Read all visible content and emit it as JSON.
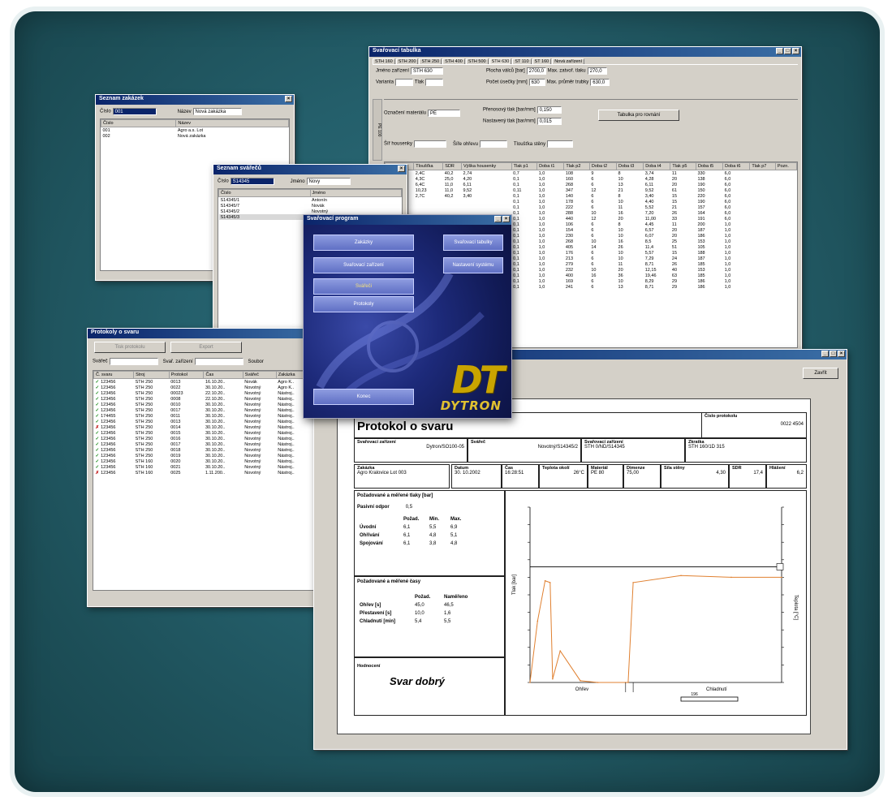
{
  "brand": {
    "logo": "DT",
    "name": "DYTRON"
  },
  "win_evid": {
    "title": "Svařovací tabulka",
    "tabs": [
      "STH 160",
      "STH 200",
      "STH 250",
      "STH 400",
      "STH 500",
      "STH 630",
      "ST 110",
      "ST 160",
      "Nová zařízení"
    ],
    "typ_label": "Jméno zařízení",
    "typ_value": "STH 630",
    "varianta_label": "Varianta",
    "varianta_value": "",
    "tlak_label": "Tlak",
    "tlak_value": "",
    "plocha_label": "Plocha válců [bar]",
    "plocha_value": "2700,0",
    "max_label": "Max. zatvoř. tlaku",
    "max_value": "270,0",
    "pocet_label": "Počet úsečky [mm]",
    "pocet_value": "630",
    "max2_label": "Max. průměr trubky",
    "max2_value": "630,0",
    "mat_label": "Označení materiálu",
    "mat_value": "PE",
    "hodnota1_label": "Přenosový tlak [bar/mm]",
    "hodnota1_value": "0,150",
    "hodnota2_label": "Nastavený tlak [bar/mm]",
    "hodnota2_value": "0,015",
    "btn": "Tabulka pro rovnání",
    "row3": [
      "Šíř housenky",
      "Šíře ohřevu",
      "Tloušťka stěny"
    ],
    "columns": [
      "Ø trubky",
      "Tloušťka",
      "SDR",
      "Výška housenky",
      "Tlak p1",
      "Doba t1",
      "Tlak p2",
      "Doba t2",
      "Doba t3",
      "Doba t4",
      "Tlak p5",
      "Doba t5",
      "Doba t6",
      "Tlak p7",
      "Pozn."
    ],
    "rows": [
      [
        "7,71",
        "2,4C",
        "40,2",
        "2,74",
        "0,7",
        "1,0",
        "108",
        "9",
        "8",
        "3,74",
        "11",
        "330",
        "6,0"
      ],
      [
        "12,35",
        "4,3C",
        "25,0",
        "4,20",
        "0,1",
        "1,0",
        "160",
        "6",
        "10",
        "4,28",
        "20",
        "138",
        "6,0"
      ],
      [
        "10,04",
        "6,4C",
        "11,0",
        "6,11",
        "0,1",
        "1,0",
        "268",
        "6",
        "13",
        "6,11",
        "20",
        "190",
        "6,0"
      ],
      [
        "28,35",
        "10,23",
        "11,0",
        "9,52",
        "0,11",
        "1,0",
        "347",
        "12",
        "21",
        "9,52",
        "61",
        "150",
        "6,0"
      ],
      [
        "8,71",
        "2,7C",
        "40,2",
        "3,40",
        "0,1",
        "1,0",
        "140",
        "6",
        "8",
        "3,40",
        "15",
        "220",
        "6,0"
      ],
      [
        "",
        "",
        "",
        "",
        "0,1",
        "1,0",
        "178",
        "6",
        "10",
        "4,40",
        "15",
        "190",
        "6,0"
      ],
      [
        "",
        "",
        "",
        "",
        "0,1",
        "1,0",
        "222",
        "6",
        "11",
        "5,52",
        "21",
        "157",
        "6,0"
      ],
      [
        "",
        "",
        "",
        "",
        "0,1",
        "1,0",
        "288",
        "10",
        "16",
        "7,20",
        "26",
        "164",
        "6,0"
      ],
      [
        "",
        "",
        "",
        "",
        "0,1",
        "1,0",
        "440",
        "12",
        "20",
        "11,00",
        "33",
        "191",
        "6,0"
      ],
      [
        "",
        "",
        "",
        "",
        "0,1",
        "1,0",
        "106",
        "6",
        "8",
        "4,45",
        "11",
        "200",
        "1,0"
      ],
      [
        "",
        "",
        "",
        "",
        "0,1",
        "1,0",
        "154",
        "6",
        "10",
        "6,57",
        "20",
        "187",
        "1,0"
      ],
      [
        "",
        "",
        "",
        "",
        "0,1",
        "1,0",
        "230",
        "6",
        "10",
        "6,07",
        "20",
        "186",
        "1,0"
      ],
      [
        "",
        "",
        "",
        "",
        "0,1",
        "1,0",
        "268",
        "10",
        "16",
        "8,5",
        "25",
        "153",
        "1,0"
      ],
      [
        "",
        "",
        "",
        "",
        "0,1",
        "1,0",
        "405",
        "14",
        "26",
        "11,4",
        "51",
        "105",
        "1,0"
      ],
      [
        "",
        "",
        "",
        "",
        "0,1",
        "1,0",
        "176",
        "6",
        "10",
        "5,57",
        "15",
        "188",
        "1,0"
      ],
      [
        "",
        "",
        "",
        "",
        "0,1",
        "1,0",
        "213",
        "6",
        "10",
        "7,29",
        "24",
        "187",
        "1,0"
      ],
      [
        "",
        "",
        "",
        "",
        "0,1",
        "1,0",
        "279",
        "6",
        "11",
        "8,71",
        "26",
        "185",
        "1,0"
      ],
      [
        "",
        "",
        "",
        "",
        "0,1",
        "1,0",
        "232",
        "10",
        "20",
        "12,15",
        "40",
        "153",
        "1,0"
      ],
      [
        "",
        "",
        "",
        "",
        "0,1",
        "1,0",
        "400",
        "16",
        "36",
        "19,46",
        "63",
        "185",
        "1,0"
      ],
      [
        "",
        "",
        "",
        "",
        "0,1",
        "1,0",
        "169",
        "6",
        "10",
        "8,29",
        "29",
        "186",
        "1,0"
      ],
      [
        "",
        "",
        "",
        "",
        "0,1",
        "1,0",
        "241",
        "6",
        "13",
        "8,71",
        "29",
        "186",
        "1,0"
      ]
    ]
  },
  "win_zakaz": {
    "title": "Seznam zakázek",
    "cislo_label": "Číslo",
    "cislo_value": "001",
    "nazev_label": "Název",
    "nazev_value": "Nová zakázka",
    "col1": "Číslo",
    "col2": "Název",
    "rows": [
      [
        "001",
        "Agro a.s. Lot"
      ],
      [
        "002",
        "Nová zakázka"
      ]
    ]
  },
  "win_svarec": {
    "title": "Seznam svářečů",
    "cislo_label": "Číslo",
    "cislo_value": "S14345",
    "jmeno_label": "Jméno",
    "jmeno_value": "Novy",
    "col1": "Číslo",
    "col2": "Jméno",
    "rows": [
      [
        "S14345/1",
        "Antonín"
      ],
      [
        "S14345/7",
        "Novák"
      ],
      [
        "S14345/2",
        "Novotný"
      ],
      [
        "S14345/3",
        "Novotný"
      ]
    ]
  },
  "menu": {
    "title": "Svařovací program",
    "buttons_left": [
      "Zakázky",
      "Svařovací zařízení",
      "Svářeči",
      "Protokoly"
    ],
    "buttons_right": [
      "Svařovací tabulky",
      "Nastavení systému"
    ],
    "bottom_btn": "Konec"
  },
  "win_protokoly": {
    "title": "Protokoly o svaru",
    "btn1": "Tisk protokolu",
    "btn2": "Export",
    "filter1_label": "Svářeč",
    "filter2_label": "Svař. zařízení",
    "filter3_label": "Soubor",
    "columns": [
      "Č. svaru",
      "Stroj",
      "Protokol",
      "Čas",
      "Svářeč",
      "Zakázka",
      ""
    ],
    "rows": [
      [
        "ok",
        "123456",
        "STH 250",
        "0013",
        "16.10.20..",
        "Novák",
        "Agro K.."
      ],
      [
        "ok",
        "123456",
        "STH 250",
        "0022",
        "30.10.20..",
        "Novotný",
        "Agro K.."
      ],
      [
        "ok",
        "123456",
        "STH 250",
        "00023",
        "22.10.20..",
        "Novotný",
        "Nástroj.."
      ],
      [
        "ok",
        "123456",
        "STH 250",
        "0008",
        "22.10.20..",
        "Novotný",
        "Nástroj.."
      ],
      [
        "ok",
        "123456",
        "STH 250",
        "0010",
        "30.10.20..",
        "Novotný",
        "Nástroj.."
      ],
      [
        "ok",
        "123456",
        "STH 250",
        "0017",
        "30.10.20..",
        "Novotný",
        "Nástroj.."
      ],
      [
        "ok",
        "174455",
        "STH 250",
        "0011",
        "30.10.20..",
        "Novotný",
        "Nástroj.."
      ],
      [
        "ok",
        "123456",
        "STH 250",
        "0013",
        "30.10.20..",
        "Novotný",
        "Nástroj.."
      ],
      [
        "x",
        "123456",
        "STH 250",
        "0014",
        "30.10.20..",
        "Novotný",
        "Nástroj.."
      ],
      [
        "ok",
        "123456",
        "STH 250",
        "0015",
        "30.10.20..",
        "Novotný",
        "Nástroj.."
      ],
      [
        "ok",
        "123456",
        "STH 250",
        "0016",
        "30.10.20..",
        "Novotný",
        "Nástroj.."
      ],
      [
        "ok",
        "123456",
        "STH 250",
        "0017",
        "30.10.20..",
        "Novotný",
        "Nástroj.."
      ],
      [
        "ok",
        "123456",
        "STH 250",
        "0018",
        "30.10.20..",
        "Novotný",
        "Nástroj.."
      ],
      [
        "ok",
        "123456",
        "STH 250",
        "0019",
        "30.10.20..",
        "Novotný",
        "Nástroj.."
      ],
      [
        "ok",
        "123456",
        "STH 160",
        "0020",
        "30.10.20..",
        "Novotný",
        "Nástroj.."
      ],
      [
        "ok",
        "123456",
        "STH 160",
        "0021",
        "30.10.20..",
        "Novotný",
        "Nástroj.."
      ],
      [
        "x",
        "123456",
        "STH 160",
        "0025",
        "1.11.200..",
        "Novotný",
        "Nástroj.."
      ]
    ]
  },
  "report_win": {
    "close_btn": "Zavřít",
    "title": "Protokol o svaru",
    "cislo_label": "Číslo protokolu",
    "cislo_value": "0022 4504",
    "svar_label": "Svařovací zařízení",
    "svar_value": "Dytron/SO100-05",
    "svarec_label": "Svářeč",
    "svarec_value": "Novotný/S14345/2",
    "za_label": "Svařovací zařízení",
    "za_value": "STH 0/ND/S14345",
    "zk_label": "Zkratka",
    "zk_value": "STH 160/1D 315",
    "zakaznik_label": "Zakázka",
    "zakaznik_value": "Agro Kralovice Lot 003",
    "datum_label": "Datum",
    "datum_value": "30. 10.2002",
    "cas_label": "Čas",
    "cas_value": "16:28:51",
    "teplota_label": "Teplota okolí",
    "teplota_value": "26°C",
    "mat_label": "Materiál",
    "mat_value": "PE 80",
    "dim_label": "Dimenze",
    "dim_value": "75,00",
    "sila_label": "Síla stěny",
    "sila_value": "4,30",
    "sdr_label": "SDR",
    "sdr_value": "17,4",
    "hm_label": "Hlášení",
    "hm_value": "6,2",
    "tlak_title": "Požadované a měřené tlaky [bar]",
    "pasivni_label": "Pasivní odpor",
    "pasivni_value": "0,5",
    "tlak_cols": [
      "Požad.",
      "Min.",
      "Max."
    ],
    "tlak_rows": [
      [
        "Úvodní",
        "6,1",
        "5,5",
        "6,9"
      ],
      [
        "Ohřívání",
        "6,1",
        "4,8",
        "5,1"
      ],
      [
        "Spojování",
        "6,1",
        "3,8",
        "4,8"
      ]
    ],
    "cas_title": "Požadované a měřené časy",
    "cas_cols": [
      "Požad.",
      "Naměřeno"
    ],
    "cas_rows": [
      [
        "Ohřev [s]",
        "45,0",
        "46,5"
      ],
      [
        "Přestavení [s]",
        "10,0",
        "1,6"
      ],
      [
        "Chladnutí [min]",
        "5,4",
        "5,5"
      ]
    ],
    "hodnoceni_label": "Hodnocení",
    "hodnoceni_value": "Svar dobrý",
    "chart_ylabel": "Tlak [bar]",
    "chart_ylabel2": "Teplota [°C]",
    "chart_xlabel_1": "Ohřev",
    "chart_xlabel_2": "Chladnutí",
    "chart_value_note": "196"
  },
  "chart_data": {
    "type": "line",
    "x": [
      0,
      3,
      6,
      8,
      9,
      12,
      20,
      27,
      38,
      39,
      41,
      60,
      80,
      100
    ],
    "series": [
      {
        "values": [
          0,
          3.5,
          5.8,
          5.7,
          0.2,
          1.8,
          0.1,
          0,
          0,
          0,
          5.7,
          6.1,
          6.0,
          6.0
        ]
      }
    ],
    "ylim": [
      0,
      10
    ],
    "grid": false
  }
}
